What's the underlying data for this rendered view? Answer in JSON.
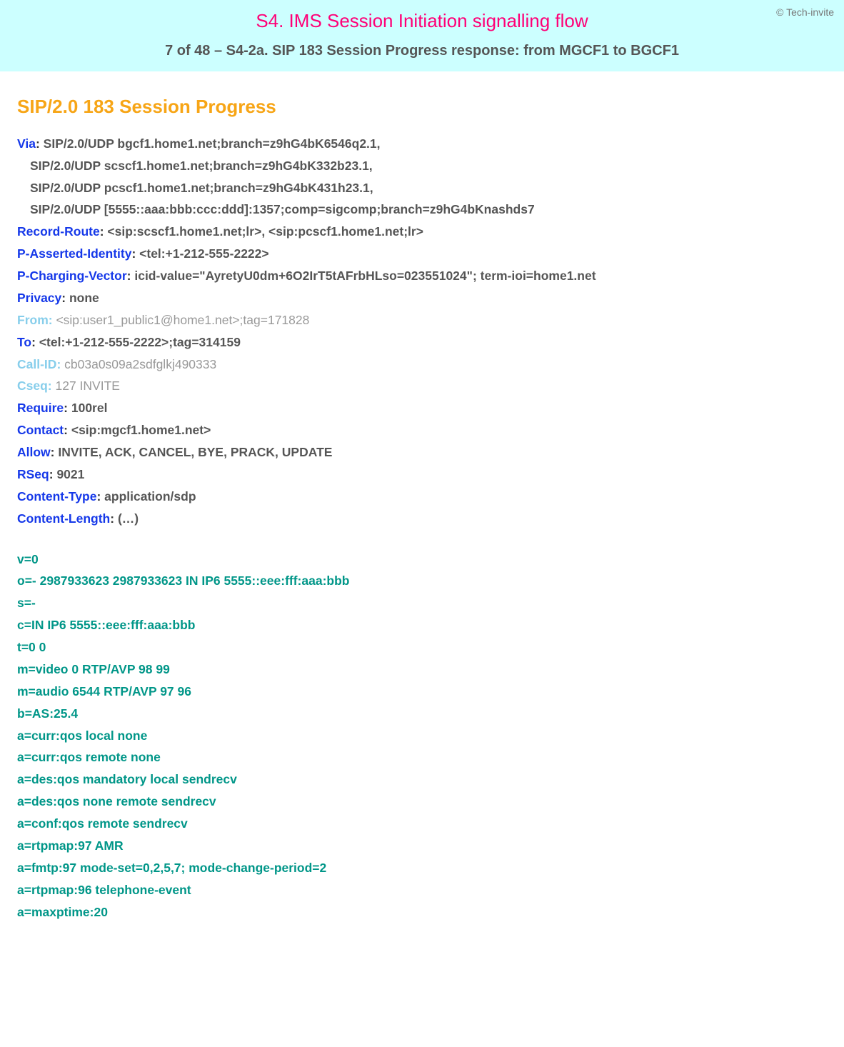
{
  "copyright": "© Tech-invite",
  "banner": {
    "title": "S4. IMS Session Initiation signalling flow",
    "subtitle": "7 of 48 – S4-2a. SIP 183 Session Progress response: from MGCF1 to BGCF1"
  },
  "requestLine": "SIP/2.0 183 Session Progress",
  "headers": [
    {
      "name": "Via",
      "value": "SIP/2.0/UDP bgcf1.home1.net;branch=z9hG4bK6546q2.1,",
      "style": "normal",
      "continues": [
        "SIP/2.0/UDP scscf1.home1.net;branch=z9hG4bK332b23.1,",
        "SIP/2.0/UDP pcscf1.home1.net;branch=z9hG4bK431h23.1,",
        "SIP/2.0/UDP [5555::aaa:bbb:ccc:ddd]:1357;comp=sigcomp;branch=z9hG4bKnashds7"
      ]
    },
    {
      "name": "Record-Route",
      "value": "<sip:scscf1.home1.net;lr>, <sip:pcscf1.home1.net;lr>",
      "style": "normal"
    },
    {
      "name": "P-Asserted-Identity",
      "value": "<tel:+1-212-555-2222>",
      "style": "normal"
    },
    {
      "name": "P-Charging-Vector",
      "value": "icid-value=\"AyretyU0dm+6O2IrT5tAFrbHLso=023551024\"; term-ioi=home1.net",
      "style": "normal"
    },
    {
      "name": "Privacy",
      "value": "none",
      "style": "normal"
    },
    {
      "name": "From",
      "value": "<sip:user1_public1@home1.net>;tag=171828",
      "style": "light"
    },
    {
      "name": "To",
      "value": "<tel:+1-212-555-2222>;tag=314159",
      "style": "normal"
    },
    {
      "name": "Call-ID",
      "value": "cb03a0s09a2sdfglkj490333",
      "style": "light"
    },
    {
      "name": "Cseq",
      "value": "127 INVITE",
      "style": "light"
    },
    {
      "name": "Require",
      "value": "100rel",
      "style": "normal"
    },
    {
      "name": "Contact",
      "value": "<sip:mgcf1.home1.net>",
      "style": "normal"
    },
    {
      "name": "Allow",
      "value": "INVITE, ACK, CANCEL, BYE, PRACK, UPDATE",
      "style": "normal"
    },
    {
      "name": "RSeq",
      "value": "9021",
      "style": "normal"
    },
    {
      "name": "Content-Type",
      "value": "application/sdp",
      "style": "normal"
    },
    {
      "name": "Content-Length",
      "value": "(…)",
      "style": "normal"
    }
  ],
  "sdp": [
    "v=0",
    "o=- 2987933623 2987933623 IN IP6 5555::eee:fff:aaa:bbb",
    "s=-",
    "c=IN IP6 5555::eee:fff:aaa:bbb",
    "t=0 0",
    "m=video 0 RTP/AVP 98 99",
    "m=audio 6544 RTP/AVP 97 96",
    "b=AS:25.4",
    "a=curr:qos local none",
    "a=curr:qos remote none",
    "a=des:qos mandatory local sendrecv",
    "a=des:qos none remote sendrecv",
    "a=conf:qos remote sendrecv",
    "a=rtpmap:97 AMR",
    "a=fmtp:97 mode-set=0,2,5,7; mode-change-period=2",
    "a=rtpmap:96 telephone-event",
    "a=maxptime:20"
  ]
}
